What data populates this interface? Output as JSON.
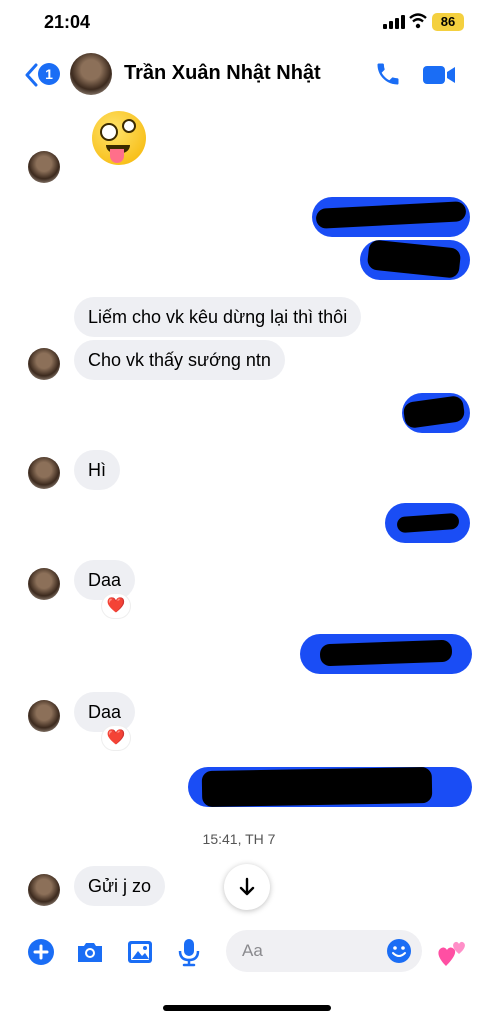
{
  "status_bar": {
    "time": "21:04",
    "battery": "86"
  },
  "header": {
    "back_badge": "1",
    "contact_name": "Trần Xuân Nhật Nhật",
    "call_icon": "phone-icon",
    "video_icon": "video-camera-icon"
  },
  "messages": {
    "m1": {
      "emoji": "zany-face-emoji"
    },
    "m2": {
      "text": "Liếm cho vk kêu dừng lại thì thôi"
    },
    "m3": {
      "text": "Cho vk thấy sướng ntn"
    },
    "m4": {
      "text": "Hì"
    },
    "m5": {
      "text": "Daa",
      "reaction": "❤️"
    },
    "m6": {
      "text": "Daa",
      "reaction": "❤️"
    },
    "m7": {
      "text": "Gửi j zo"
    }
  },
  "timestamp": "15:41, TH 7",
  "composer": {
    "placeholder": "Aa",
    "icons": [
      "plus-circle-icon",
      "camera-icon",
      "image-icon",
      "microphone-icon",
      "smiley-icon",
      "hearts-icon"
    ]
  },
  "colors": {
    "accent": "#1a6df5",
    "outgoing_bubble": "#1a4df5",
    "incoming_bubble": "#eeeff3"
  }
}
